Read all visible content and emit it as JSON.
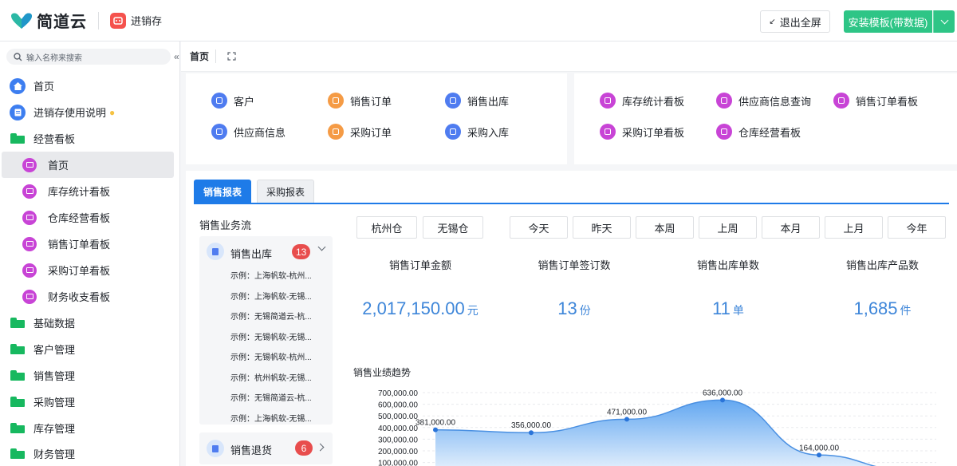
{
  "header": {
    "brand": "简道云",
    "app_name": "进销存",
    "exit_fullscreen": "退出全屏",
    "install_template": "安装模板(带数据)"
  },
  "sidebar": {
    "search_placeholder": "输入名称来搜索",
    "items": [
      {
        "label": "首页",
        "icon": "home-icon"
      },
      {
        "label": "进销存使用说明",
        "icon": "doc-icon"
      },
      {
        "label": "经营看板",
        "icon": "folder-open-icon"
      },
      {
        "label": "首页",
        "icon": "dashboard-icon",
        "active": true
      },
      {
        "label": "库存统计看板",
        "icon": "dashboard-icon"
      },
      {
        "label": "仓库经营看板",
        "icon": "dashboard-icon"
      },
      {
        "label": "销售订单看板",
        "icon": "dashboard-icon"
      },
      {
        "label": "采购订单看板",
        "icon": "dashboard-icon"
      },
      {
        "label": "财务收支看板",
        "icon": "dashboard-icon"
      },
      {
        "label": "基础数据",
        "icon": "folder-icon"
      },
      {
        "label": "客户管理",
        "icon": "folder-icon"
      },
      {
        "label": "销售管理",
        "icon": "folder-icon"
      },
      {
        "label": "采购管理",
        "icon": "folder-icon"
      },
      {
        "label": "库存管理",
        "icon": "folder-icon"
      },
      {
        "label": "财务管理",
        "icon": "folder-icon"
      }
    ]
  },
  "page": {
    "title": "首页"
  },
  "shortcuts_left": [
    {
      "label": "客户",
      "color": "#4f7cf0"
    },
    {
      "label": "销售订单",
      "color": "#f59b45"
    },
    {
      "label": "销售出库",
      "color": "#4f7cf0"
    },
    {
      "label": "供应商信息",
      "color": "#4f7cf0"
    },
    {
      "label": "采购订单",
      "color": "#f59b45"
    },
    {
      "label": "采购入库",
      "color": "#4f7cf0"
    }
  ],
  "shortcuts_right": [
    {
      "label": "库存统计看板",
      "color": "#c844d6"
    },
    {
      "label": "供应商信息查询",
      "color": "#c844d6"
    },
    {
      "label": "销售订单看板",
      "color": "#c844d6"
    },
    {
      "label": "采购订单看板",
      "color": "#c844d6"
    },
    {
      "label": "仓库经营看板",
      "color": "#c844d6"
    }
  ],
  "report_tabs": [
    "销售报表",
    "采购报表"
  ],
  "flow": {
    "title": "销售业务流",
    "group1": {
      "label": "销售出库",
      "count": "13"
    },
    "lines": [
      "示例：上海帆软-杭州...",
      "示例：上海帆软-无锡...",
      "示例：无锡简道云-杭...",
      "示例：无锡帆软-无锡...",
      "示例：无锡帆软-杭州...",
      "示例：杭州帆软-无锡...",
      "示例：无锡简道云-杭...",
      "示例：上海帆软-无锡..."
    ],
    "group2": {
      "label": "销售退货",
      "count": "6"
    }
  },
  "filters": {
    "warehouses": [
      "杭州仓",
      "无锡仓"
    ],
    "periods": [
      "今天",
      "昨天",
      "本周",
      "上周",
      "本月",
      "上月",
      "今年"
    ]
  },
  "stats": [
    {
      "title": "销售订单金额",
      "value": "2,017,150.00",
      "unit": "元"
    },
    {
      "title": "销售订单签订数",
      "value": "13",
      "unit": "份"
    },
    {
      "title": "销售出库单数",
      "value": "11",
      "unit": "单"
    },
    {
      "title": "销售出库产品数",
      "value": "1,685",
      "unit": "件"
    }
  ],
  "chart_data": {
    "type": "area",
    "title": "销售业绩趋势",
    "y_ticks": [
      "700,000.00",
      "600,000.00",
      "500,000.00",
      "400,000.00",
      "300,000.00",
      "200,000.00",
      "100,000.00"
    ],
    "ylim": [
      0,
      700000
    ],
    "values": [
      381000,
      356000,
      471000,
      636000,
      164000,
      40000
    ],
    "value_labels": [
      "381,000.00",
      "356,000.00",
      "471,000.00",
      "636,000.00",
      "164,000.00",
      ""
    ],
    "grid": true,
    "colors": {
      "line": "#4a90e2",
      "fill_top": "#5ba3f0",
      "fill_bottom": "#eaf3fd"
    }
  }
}
